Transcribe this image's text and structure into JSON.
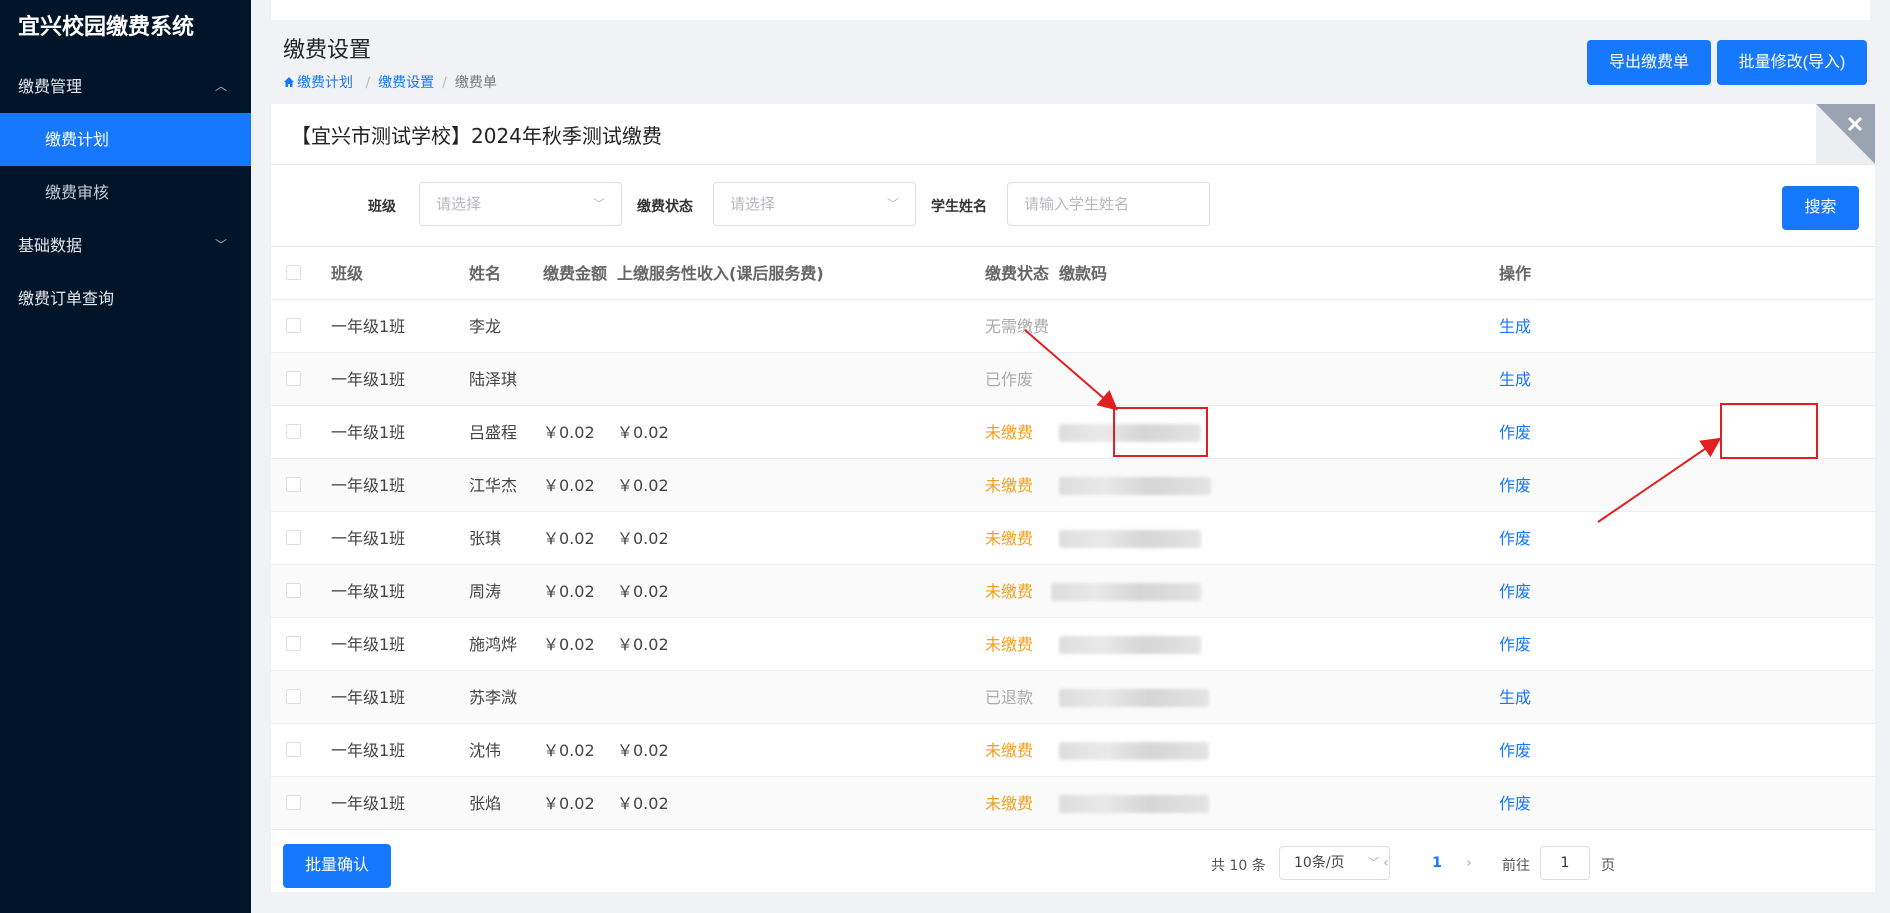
{
  "app": {
    "title": "宜兴校园缴费系统"
  },
  "sidebar": {
    "groups": [
      {
        "label": "缴费管理",
        "items": [
          {
            "label": "缴费计划"
          },
          {
            "label": "缴费审核"
          }
        ]
      },
      {
        "label": "基础数据"
      },
      {
        "label": "缴费订单查询"
      }
    ]
  },
  "header": {
    "title": "缴费设置",
    "breadcrumb": [
      "缴费计划",
      "缴费设置",
      "缴费单"
    ],
    "export_label": "导出缴费单",
    "batch_edit_label": "批量修改(导入)"
  },
  "panel": {
    "title": "【宜兴市测试学校】2024年秋季测试缴费"
  },
  "filters": {
    "class_label": "班级",
    "class_placeholder": "请选择",
    "status_label": "缴费状态",
    "status_placeholder": "请选择",
    "name_label": "学生姓名",
    "name_placeholder": "请输入学生姓名",
    "search_label": "搜索"
  },
  "table": {
    "columns": [
      "班级",
      "姓名",
      "缴费金额",
      "上缴服务性收入(课后服务费)",
      "缴费状态",
      "缴款码",
      "操作"
    ],
    "rows": [
      {
        "class": "一年级1班",
        "name": "李龙",
        "amount": "",
        "service_fee": "",
        "status": "无需缴费",
        "code": "",
        "action": "生成"
      },
      {
        "class": "一年级1班",
        "name": "陆泽琪",
        "amount": "",
        "service_fee": "",
        "status": "已作废",
        "code": "",
        "action": "生成"
      },
      {
        "class": "一年级1班",
        "name": "吕盛程",
        "amount": "￥0.02",
        "service_fee": "￥0.02",
        "status": "未缴费",
        "code": "",
        "action": "作废"
      },
      {
        "class": "一年级1班",
        "name": "江华杰",
        "amount": "￥0.02",
        "service_fee": "￥0.02",
        "status": "未缴费",
        "code": "",
        "action": "作废"
      },
      {
        "class": "一年级1班",
        "name": "张琪",
        "amount": "￥0.02",
        "service_fee": "￥0.02",
        "status": "未缴费",
        "code": "",
        "action": "作废"
      },
      {
        "class": "一年级1班",
        "name": "周涛",
        "amount": "￥0.02",
        "service_fee": "￥0.02",
        "status": "未缴费",
        "code": "",
        "action": "作废"
      },
      {
        "class": "一年级1班",
        "name": "施鸿烨",
        "amount": "￥0.02",
        "service_fee": "￥0.02",
        "status": "未缴费",
        "code": "",
        "action": "作废"
      },
      {
        "class": "一年级1班",
        "name": "苏李溦",
        "amount": "",
        "service_fee": "",
        "status": "已退款",
        "code": "",
        "action": "生成"
      },
      {
        "class": "一年级1班",
        "name": "沈伟",
        "amount": "￥0.02",
        "service_fee": "￥0.02",
        "status": "未缴费",
        "code": "",
        "action": "作废"
      },
      {
        "class": "一年级1班",
        "name": "张焰",
        "amount": "￥0.02",
        "service_fee": "￥0.02",
        "status": "未缴费",
        "code": "",
        "action": "作废"
      }
    ]
  },
  "footer": {
    "batch_confirm_label": "批量确认",
    "total_text": "共 10 条",
    "page_size": "10条/页",
    "current_page": "1",
    "goto_prefix": "前往",
    "goto_value": "1",
    "goto_suffix": "页"
  },
  "colors": {
    "accent": "#1677ff",
    "sidebar_bg": "#001529",
    "unpaid": "#f0a020",
    "annotation": "#e02020"
  }
}
